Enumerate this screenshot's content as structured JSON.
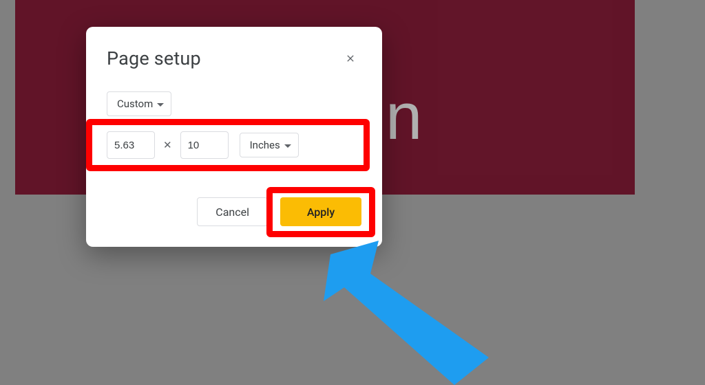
{
  "dialog": {
    "title": "Page setup",
    "preset_label": "Custom",
    "width_value": "5.63",
    "height_value": "10",
    "unit_label": "Inches",
    "cancel_label": "Cancel",
    "apply_label": "Apply"
  },
  "background": {
    "letter": "n"
  }
}
